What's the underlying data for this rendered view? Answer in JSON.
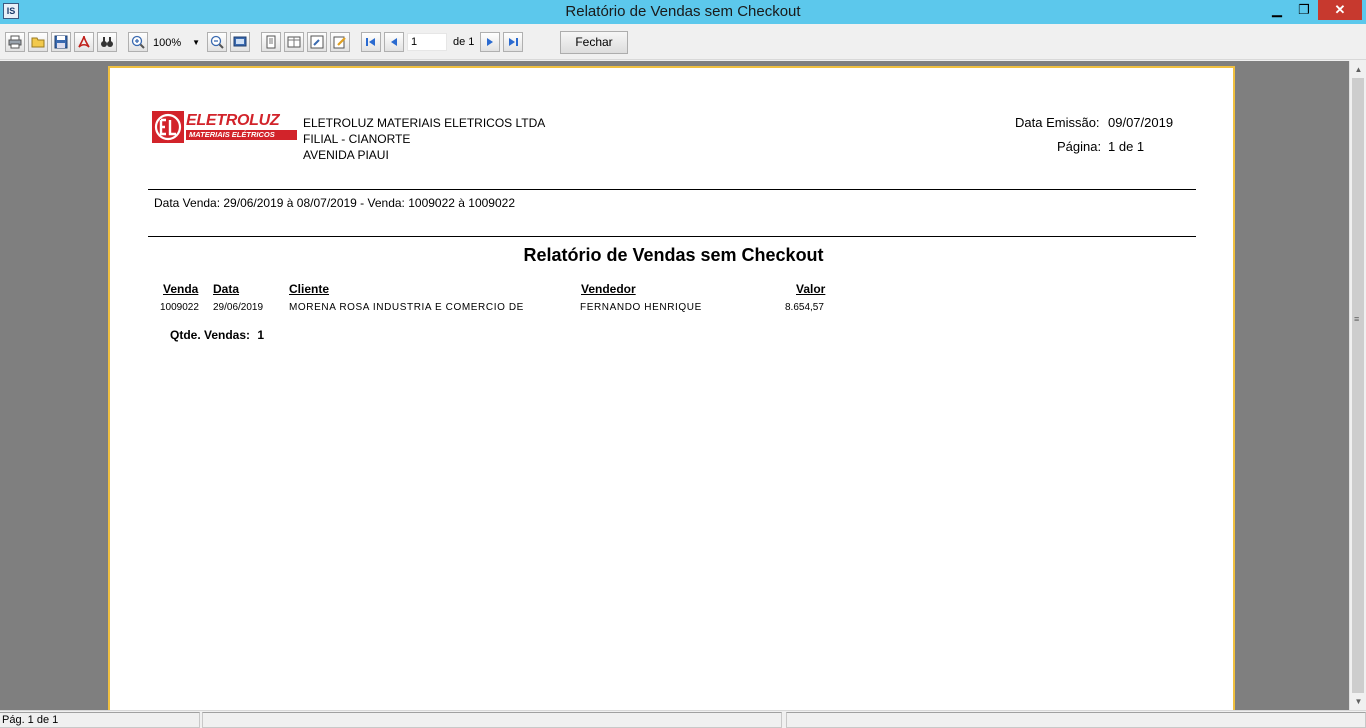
{
  "window": {
    "title": "Relatório de Vendas sem Checkout",
    "app_icon": "IS"
  },
  "toolbar": {
    "zoom": "100%",
    "page_number": "1",
    "page_of": "de 1",
    "close_label": "Fechar"
  },
  "report": {
    "logo": {
      "brand": "ELETROLUZ",
      "tagline": "MATERIAIS ELÉTRICOS"
    },
    "company_lines": [
      "ELETROLUZ MATERIAIS ELETRICOS LTDA",
      "FILIAL - CIANORTE",
      "AVENIDA PIAUI"
    ],
    "emission_label": "Data Emissão:",
    "emission_date": "09/07/2019",
    "page_label": "Página:",
    "page_value": "1 de 1",
    "filter_text": "Data Venda: 29/06/2019 à 08/07/2019 - Venda: 1009022 à 1009022",
    "title": "Relatório de Vendas sem Checkout",
    "columns": {
      "venda": "Venda",
      "data": "Data",
      "cliente": "Cliente",
      "vendedor": "Vendedor",
      "valor": "Valor"
    },
    "rows": [
      {
        "venda": "1009022",
        "data": "29/06/2019",
        "cliente": "MORENA ROSA INDUSTRIA E COMERCIO DE",
        "vendedor": "FERNANDO HENRIQUE",
        "valor": "8.654,57"
      }
    ],
    "count_label": "Qtde. Vendas:",
    "count_value": "1"
  },
  "statusbar": {
    "page_text": "Pág. 1 de 1"
  },
  "colors": {
    "titlebar": "#5cc8ec",
    "close_button": "#c7392e",
    "page_border": "#f0c040",
    "viewer_bg": "#7f7f7f",
    "logo_red": "#d2232a"
  }
}
